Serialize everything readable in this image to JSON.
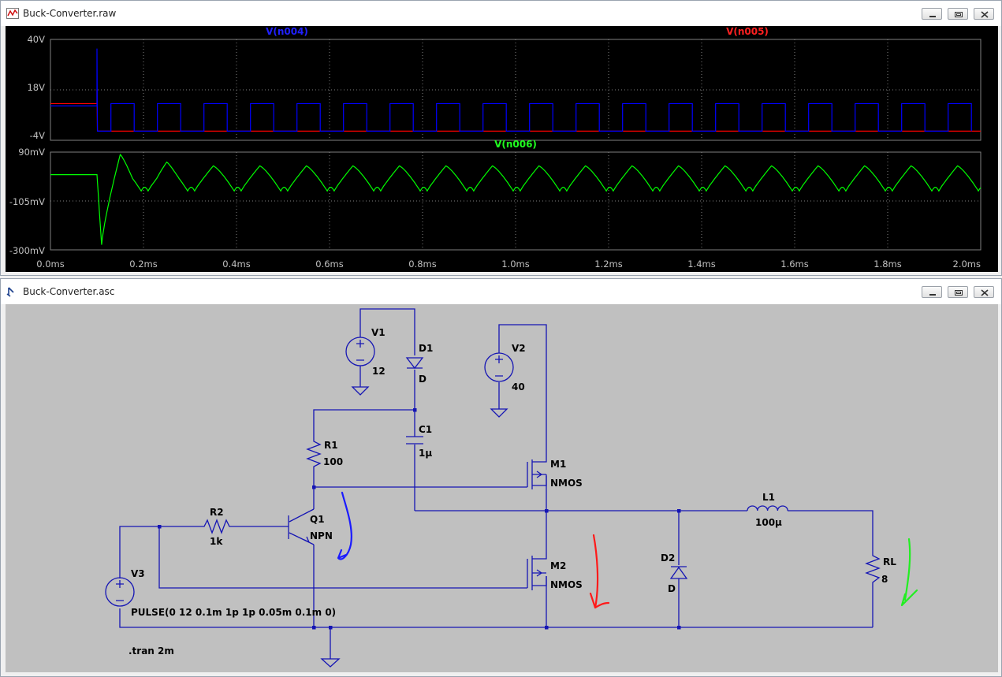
{
  "waveform_window": {
    "title": "Buck-Converter.raw",
    "buttons": [
      "minimize",
      "maximize",
      "close"
    ]
  },
  "schematic_window": {
    "title": "Buck-Converter.asc",
    "buttons": [
      "minimize",
      "maximize",
      "close"
    ]
  },
  "colors": {
    "trace_n004": "#0000ff",
    "trace_n005": "#ff0000",
    "trace_n006": "#00ff00",
    "grid": "#808080",
    "plot_bg": "#000000",
    "schematic_bg": "#c0c0c0",
    "wire": "#1515b4",
    "annotation_blue": "#1a1aff",
    "annotation_red": "#ff1a1a",
    "annotation_green": "#22ee22"
  },
  "chart_data": [
    {
      "type": "line",
      "pane": "upper",
      "x_ticks": [
        "0.0ms",
        "0.2ms",
        "0.4ms",
        "0.6ms",
        "0.8ms",
        "1.0ms",
        "1.2ms",
        "1.4ms",
        "1.6ms",
        "1.8ms",
        "2.0ms"
      ],
      "y_ticks": [
        "40V",
        "18V",
        "-4V"
      ],
      "xlim_ms": [
        0,
        2.0
      ],
      "ylim_V": [
        -4,
        40
      ],
      "series": [
        {
          "name": "V(n004)",
          "color": "#0000ff",
          "shape": "square pulse",
          "initial_level_V": 11,
          "switch_time_ms": 0.1,
          "spike_V": 36,
          "low_V": 0,
          "high_V": 12,
          "period_ms": 0.1,
          "pulse_width_ms": 0.05,
          "pulse_delay_ms": 0.1
        },
        {
          "name": "V(n005)",
          "color": "#ff0000",
          "shape": "step then flat",
          "initial_level_V": 12,
          "spike_V": 18,
          "switch_time_ms": 0.1,
          "level_after_V": 0
        }
      ]
    },
    {
      "type": "line",
      "pane": "lower",
      "x_ticks": [
        "0.0ms",
        "0.2ms",
        "0.4ms",
        "0.6ms",
        "0.8ms",
        "1.0ms",
        "1.2ms",
        "1.4ms",
        "1.6ms",
        "1.8ms",
        "2.0ms"
      ],
      "y_ticks": [
        "90mV",
        "-105mV",
        "-300mV"
      ],
      "xlim_ms": [
        0,
        2.0
      ],
      "ylim_mV": [
        -300,
        90
      ],
      "series": [
        {
          "name": "V(n006)",
          "color": "#00ff00",
          "initial_level_mV": 0,
          "dip_time_ms": 0.11,
          "dip_mV": -280,
          "overshoot_time_ms": 0.15,
          "overshoot_mV": 80,
          "ripple_period_ms": 0.1,
          "ripple_high_mV": 35,
          "ripple_low_mV": -65
        }
      ]
    }
  ],
  "schematic": {
    "components": {
      "v1": {
        "name": "V1",
        "value": "12"
      },
      "v2": {
        "name": "V2",
        "value": "40"
      },
      "v3": {
        "name": "V3",
        "value": "PULSE(0 12 0.1m 1p 1p 0.05m 0.1m 0)"
      },
      "d1": {
        "name": "D1",
        "value": "D"
      },
      "d2": {
        "name": "D2",
        "value": "D"
      },
      "c1": {
        "name": "C1",
        "value": "1µ"
      },
      "r1": {
        "name": "R1",
        "value": "100"
      },
      "r2": {
        "name": "R2",
        "value": "1k"
      },
      "q1": {
        "name": "Q1",
        "value": "NPN"
      },
      "m1": {
        "name": "M1",
        "value": "NMOS"
      },
      "m2": {
        "name": "M2",
        "value": "NMOS"
      },
      "l1": {
        "name": "L1",
        "value": "100µ"
      },
      "rl": {
        "name": "RL",
        "value": "8"
      }
    },
    "directive": ".tran 2m"
  }
}
